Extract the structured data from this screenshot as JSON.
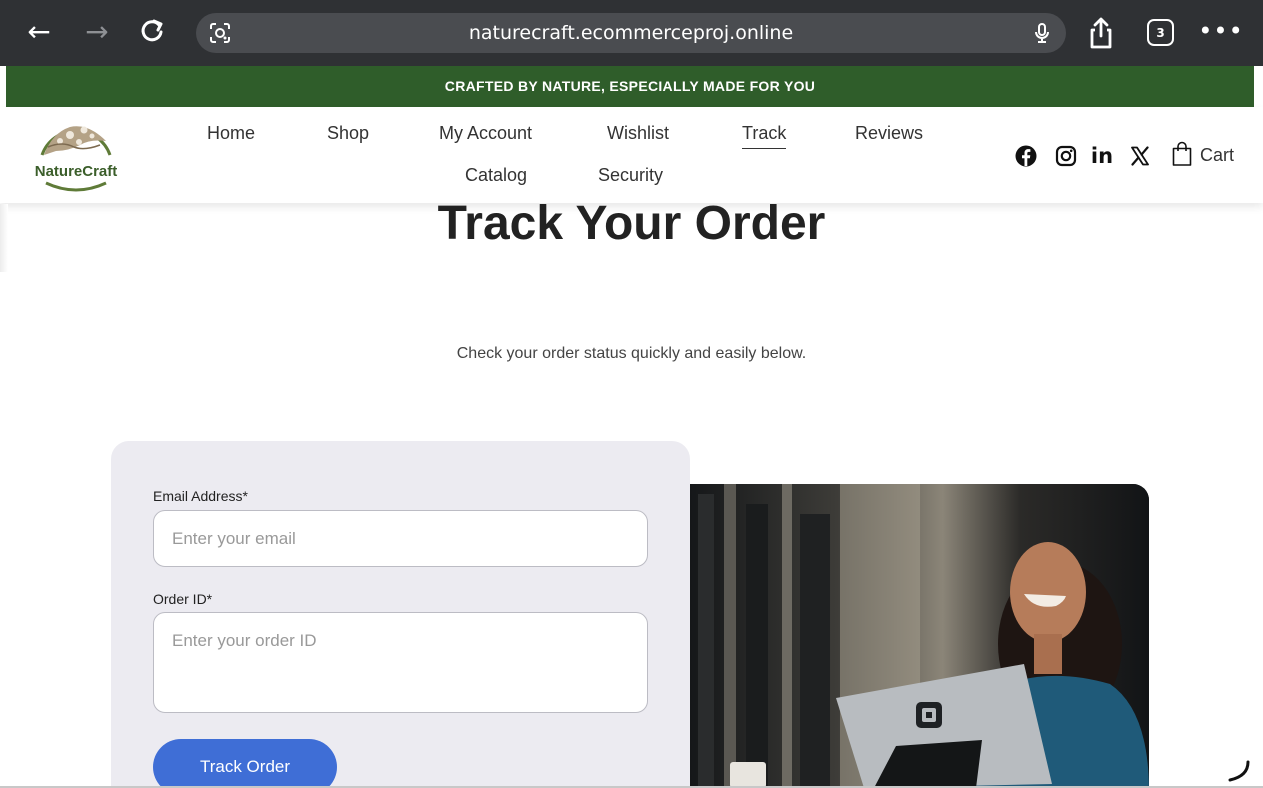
{
  "browser": {
    "url": "naturecraft.ecommerceproj.online",
    "tab_count": "3",
    "icons": [
      "back-arrow-icon",
      "forward-arrow-icon",
      "reload-icon",
      "lens-icon",
      "microphone-icon",
      "share-icon",
      "tabs-icon",
      "more-icon"
    ]
  },
  "announcement": {
    "text": "CRAFTED BY NATURE, ESPECIALLY MADE FOR YOU",
    "background": "#2f5d2a"
  },
  "header": {
    "logo_text": "NatureCraft",
    "nav": {
      "home": "Home",
      "shop": "Shop",
      "my_account": "My Account",
      "wishlist": "Wishlist",
      "track": "Track",
      "reviews": "Reviews",
      "catalog": "Catalog",
      "security": "Security"
    },
    "active_nav": "Track",
    "social_icons": [
      "facebook-icon",
      "instagram-icon",
      "linkedin-icon",
      "x-icon"
    ],
    "cart_label": "Cart"
  },
  "page": {
    "title": "Track Your Order",
    "subtitle": "Check your order status quickly and easily below."
  },
  "form": {
    "email_label": "Email Address*",
    "email_placeholder": "Enter your email",
    "order_label": "Order ID*",
    "order_placeholder": "Enter your order ID",
    "submit_label": "Track Order",
    "button_color": "#3f6ed6"
  }
}
